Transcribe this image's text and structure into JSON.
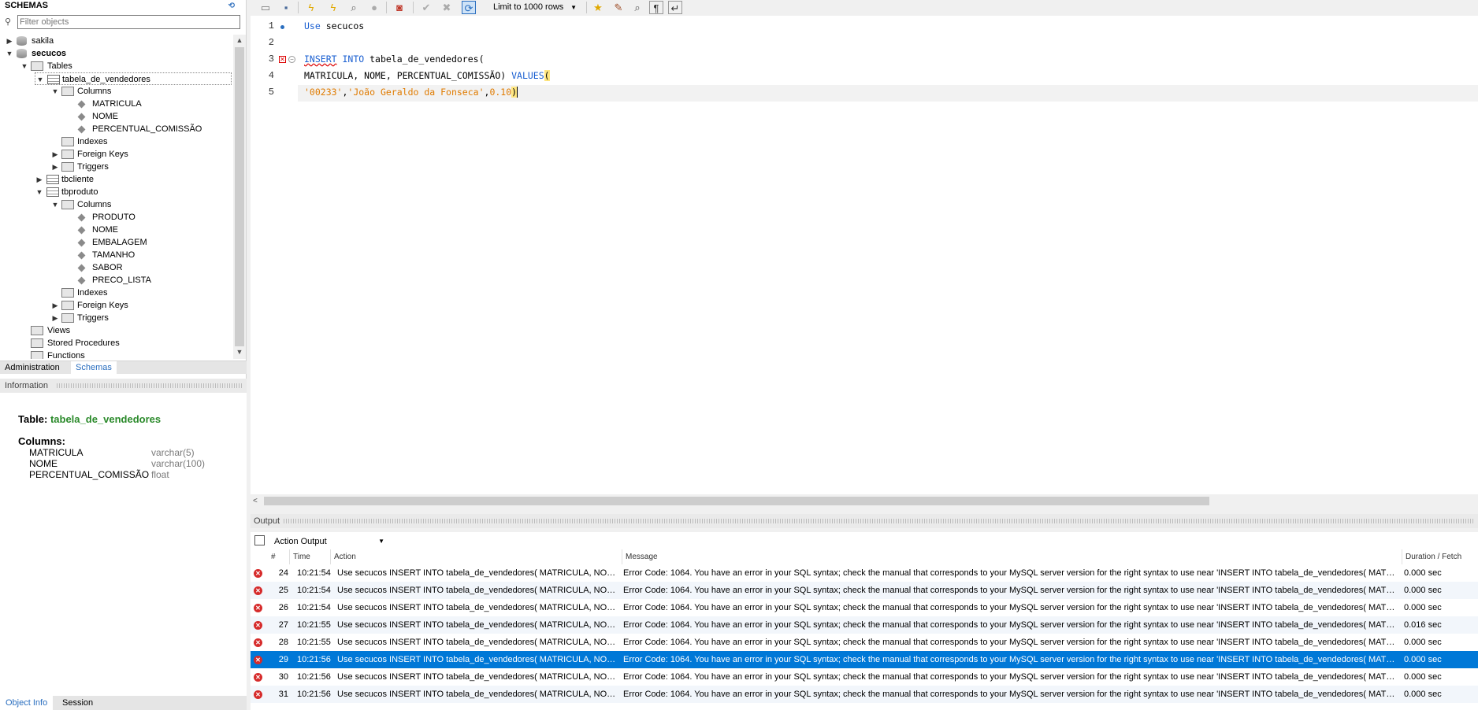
{
  "sidebar": {
    "header": "SCHEMAS",
    "filter_placeholder": "Filter objects",
    "tree": {
      "sakila": "sakila",
      "secucos": "secucos",
      "tables": "Tables",
      "t1": "tabela_de_vendedores",
      "t1_columns": "Columns",
      "t1_c1": "MATRICULA",
      "t1_c2": "NOME",
      "t1_c3": "PERCENTUAL_COMISSÃO",
      "t1_indexes": "Indexes",
      "t1_fk": "Foreign Keys",
      "t1_triggers": "Triggers",
      "t2": "tbcliente",
      "t3": "tbproduto",
      "t3_columns": "Columns",
      "t3_c1": "PRODUTO",
      "t3_c2": "NOME",
      "t3_c3": "EMBALAGEM",
      "t3_c4": "TAMANHO",
      "t3_c5": "SABOR",
      "t3_c6": "PRECO_LISTA",
      "t3_indexes": "Indexes",
      "t3_fk": "Foreign Keys",
      "t3_triggers": "Triggers",
      "views": "Views",
      "procs": "Stored Procedures",
      "funcs": "Functions"
    },
    "tabs": {
      "administration": "Administration",
      "schemas": "Schemas"
    }
  },
  "info": {
    "header": "Information",
    "table_label": "Table:",
    "table_name": "tabela_de_vendedores",
    "columns_label": "Columns:",
    "columns": [
      {
        "name": "MATRICULA",
        "type": "varchar(5)"
      },
      {
        "name": "NOME",
        "type": "varchar(100)"
      },
      {
        "name": "PERCENTUAL_COMISSÃO",
        "type": "float"
      }
    ],
    "bottom_tabs": {
      "object_info": "Object Info",
      "session": "Session"
    }
  },
  "toolbar": {
    "limit_label": "Limit to 1000 rows"
  },
  "editor": {
    "line_numbers": [
      "1",
      "2",
      "3",
      "4",
      "5"
    ],
    "line1_kw": "Use",
    "line1_rest": " secucos",
    "line3_kw1": "INSERT",
    "line3_kw2": "INTO",
    "line3_rest": " tabela_de_vendedores(",
    "line4_text": "MATRICULA, NOME, PERCENTUAL_COMISSÃO) ",
    "line4_kw": "VALUES",
    "line4_paren": "(",
    "line5_str1": "'00233'",
    "line5_comma1": ",",
    "line5_str2": "'João Geraldo da Fonseca'",
    "line5_comma2": ",",
    "line5_num": "0.10",
    "line5_paren": ")"
  },
  "output": {
    "header": "Output",
    "mode": "Action Output",
    "columns": {
      "num": "#",
      "time": "Time",
      "action": "Action",
      "message": "Message",
      "duration": "Duration / Fetch"
    },
    "rows": [
      {
        "num": "24",
        "time": "10:21:54",
        "action": "Use secucos  INSERT INTO tabela_de_vendedores( MATRICULA, NOM...",
        "message": "Error Code: 1064. You have an error in your SQL syntax; check the manual that corresponds to your MySQL server version for the right syntax to use near 'INSERT INTO tabela_de_vendedores( MATRICUL...",
        "duration": "0.000 sec"
      },
      {
        "num": "25",
        "time": "10:21:54",
        "action": "Use secucos  INSERT INTO tabela_de_vendedores( MATRICULA, NOM...",
        "message": "Error Code: 1064. You have an error in your SQL syntax; check the manual that corresponds to your MySQL server version for the right syntax to use near 'INSERT INTO tabela_de_vendedores( MATRICUL...",
        "duration": "0.000 sec"
      },
      {
        "num": "26",
        "time": "10:21:54",
        "action": "Use secucos  INSERT INTO tabela_de_vendedores( MATRICULA, NOM...",
        "message": "Error Code: 1064. You have an error in your SQL syntax; check the manual that corresponds to your MySQL server version for the right syntax to use near 'INSERT INTO tabela_de_vendedores( MATRICUL...",
        "duration": "0.000 sec"
      },
      {
        "num": "27",
        "time": "10:21:55",
        "action": "Use secucos  INSERT INTO tabela_de_vendedores( MATRICULA, NOM...",
        "message": "Error Code: 1064. You have an error in your SQL syntax; check the manual that corresponds to your MySQL server version for the right syntax to use near 'INSERT INTO tabela_de_vendedores( MATRICUL...",
        "duration": "0.016 sec"
      },
      {
        "num": "28",
        "time": "10:21:55",
        "action": "Use secucos  INSERT INTO tabela_de_vendedores( MATRICULA, NOM...",
        "message": "Error Code: 1064. You have an error in your SQL syntax; check the manual that corresponds to your MySQL server version for the right syntax to use near 'INSERT INTO tabela_de_vendedores( MATRICUL...",
        "duration": "0.000 sec"
      },
      {
        "num": "29",
        "time": "10:21:56",
        "action": "Use secucos  INSERT INTO tabela_de_vendedores( MATRICULA, NOM...",
        "message": "Error Code: 1064. You have an error in your SQL syntax; check the manual that corresponds to your MySQL server version for the right syntax to use near 'INSERT INTO tabela_de_vendedores( MATRICUL...",
        "duration": "0.000 sec"
      },
      {
        "num": "30",
        "time": "10:21:56",
        "action": "Use secucos  INSERT INTO tabela_de_vendedores( MATRICULA, NOM...",
        "message": "Error Code: 1064. You have an error in your SQL syntax; check the manual that corresponds to your MySQL server version for the right syntax to use near 'INSERT INTO tabela_de_vendedores( MATRICUL...",
        "duration": "0.000 sec"
      },
      {
        "num": "31",
        "time": "10:21:56",
        "action": "Use secucos  INSERT INTO tabela_de_vendedores( MATRICULA, NOM...",
        "message": "Error Code: 1064. You have an error in your SQL syntax; check the manual that corresponds to your MySQL server version for the right syntax to use near 'INSERT INTO tabela_de_vendedores( MATRICUL...",
        "duration": "0.000 sec"
      }
    ]
  },
  "colors": {
    "accent": "#0078d7",
    "keyword": "#1a5fd1",
    "string": "#e07b00",
    "error": "#d62b2b",
    "table_name": "#2b8a2b"
  }
}
